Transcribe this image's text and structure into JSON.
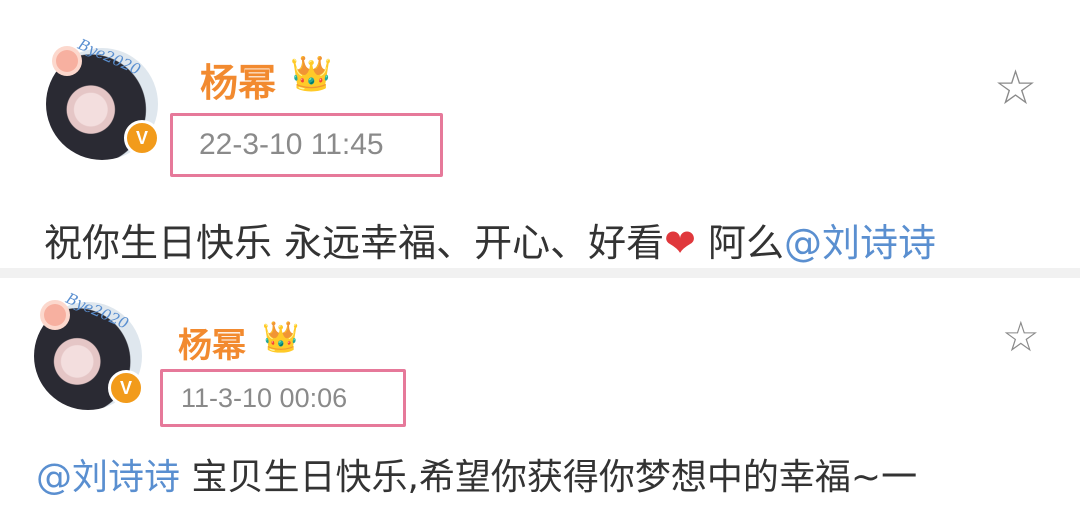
{
  "posts": [
    {
      "username": "杨幂",
      "timestamp": "22-3-10 11:45",
      "text_before": "祝你生日快乐 永远幸福、开心、好看",
      "emoji": "❤",
      "text_mid": " 阿么",
      "mention": "@刘诗诗"
    },
    {
      "username": "杨幂",
      "timestamp": "11-3-10 00:06",
      "mention": "@刘诗诗",
      "text_after": " 宝贝生日快乐,希望你获得你梦想中的幸福~一"
    }
  ],
  "icons": {
    "crown": "👑",
    "star": "☆",
    "verified": "V"
  },
  "colors": {
    "username": "#f28a2f",
    "mention": "#5a8fd0",
    "highlight_box": "#e6799a",
    "timestamp_text": "#8a8a8a",
    "verified_badge": "#f29b1b"
  }
}
